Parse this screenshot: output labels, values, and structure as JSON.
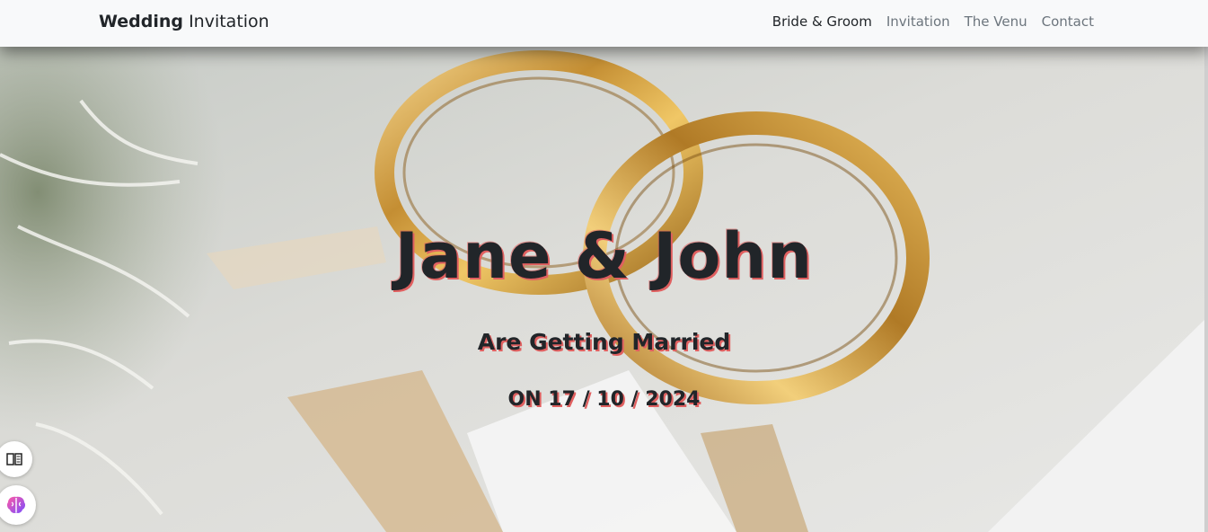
{
  "navbar": {
    "brand_bold": "Wedding",
    "brand_light": "Invitation",
    "links": [
      {
        "label": "Bride & Groom",
        "active": true
      },
      {
        "label": "Invitation",
        "active": false
      },
      {
        "label": "The Venu",
        "active": false
      },
      {
        "label": "Contact",
        "active": false
      }
    ]
  },
  "hero": {
    "names": "Jane & John",
    "subtitle": "Are Getting Married",
    "date": "ON 17 / 10 / 2024",
    "image": "gold-wedding-rings-photo"
  },
  "floating": {
    "reader_icon": "reader-mode-icon",
    "assistant_icon": "brain-assistant-icon"
  },
  "colors": {
    "navbar_bg": "#f8f9fa",
    "text_dark": "#212529",
    "text_muted": "#6c757d",
    "text_shadow": "#e06060",
    "gold": "#c9973e"
  }
}
